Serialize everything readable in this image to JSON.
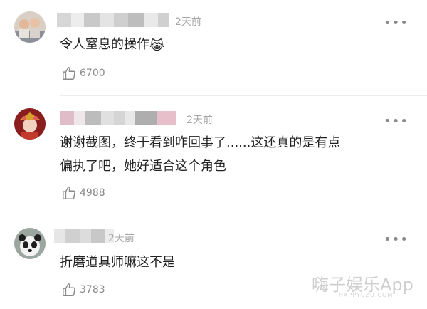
{
  "comments": [
    {
      "time": "2天前",
      "text": "令人窒息的操作",
      "emoji": "😹",
      "likes": "6700"
    },
    {
      "time": "2天前",
      "text_line1": "谢谢截图，终于看到咋回事了......这还真的是有点",
      "text_line2": "偏执了吧，她好适合这个角色",
      "likes": "4988"
    },
    {
      "time": "2天前",
      "text": "折磨道具师嘛这不是",
      "likes": "3783"
    }
  ],
  "more_label": "•••",
  "watermark": {
    "main": "嗨子娱乐App",
    "sub": "HAPPYUZU.COM"
  },
  "icons": [
    "like-icon",
    "more-icon"
  ]
}
